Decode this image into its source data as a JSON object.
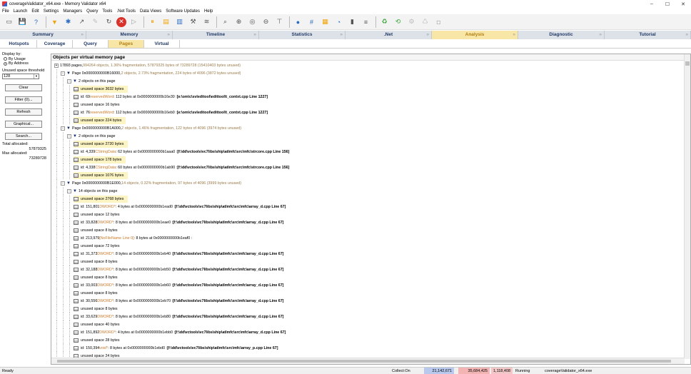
{
  "window": {
    "title": "coverageValidator_x64.exe - Memory Validator x64",
    "minimize": "–",
    "maximize": "☐",
    "close": "✕"
  },
  "menu": [
    "File",
    "Launch",
    "Edit",
    "Settings",
    "Managers",
    "Query",
    "Tools",
    ".Net Tools",
    "Data Views",
    "Software Updates",
    "Help"
  ],
  "toolbar": {
    "icons": [
      "new-file-icon",
      "save-icon",
      "help-icon",
      "filter-icon",
      "settings-icon",
      "launch-icon",
      "pen-icon",
      "refresh-icon",
      "stop-icon",
      "play-icon",
      "pause-icon",
      "chart-icon",
      "bar-chart-icon",
      "tools-icon",
      "heap-icon",
      "search-icon",
      "zoom-in-icon",
      "zoom-icon",
      "zoom-out-icon",
      "tree-icon",
      "droplet-icon",
      "hex-icon",
      "grid-icon",
      "pie-icon",
      "battery-icon",
      "list-icon",
      "recycle-green-icon",
      "recycle-back-icon",
      "gear-gray-icon",
      "recycle-gray-icon",
      "camera-icon"
    ],
    "colors": {
      "accent": "#2b6cc4",
      "stop": "#d9322b",
      "warn": "#f0a30a",
      "green": "#3aa53a"
    }
  },
  "tabs_main": [
    "Summary",
    "Memory",
    "Timeline",
    "Statistics",
    ".Net",
    "Analysis",
    "Diagnostic",
    "Tutorial"
  ],
  "tabs_main_active": "Analysis",
  "tabs_sub": [
    "Hotspots",
    "Coverage",
    "Query",
    "Pages",
    "Virtual"
  ],
  "tabs_sub_active": "Pages",
  "left": {
    "display_by": "Display by:",
    "by_usage": "By Usage",
    "by_address": "By Address",
    "threshold_label": "Unused space threshold",
    "threshold_value": "128",
    "clear": "Clear",
    "filter": "Filter (0)...",
    "refresh": "Refresh",
    "graphical": "Graphical...",
    "search": "Search...",
    "total_label": "Total allocated:",
    "total_value": "57879325",
    "max_label": "Max allocated:",
    "max_value": "73289728"
  },
  "main": {
    "header": "Objects per virtual memory page",
    "rows": [
      {
        "level": 0,
        "exp": "+",
        "t": "17893 pages, ",
        "o": "994264 objects, 1.36% fragmentation, 57879325 bytes of 73289728 (15410403 bytes unused)"
      },
      {
        "level": 1,
        "exp": "-",
        "tri": true,
        "t": "Page 0x0000000000B16000, ",
        "o": "2 objects, 2.73% fragmentation, 224 bytes of 4096 (3872 bytes unused)"
      },
      {
        "level": 2,
        "exp": "-",
        "tri": true,
        "t": "2 objects on this page"
      },
      {
        "level": 3,
        "hl": true,
        "t": "unused space 3632 bytes"
      },
      {
        "level": 3,
        "t": "id: 69 ",
        "o": "reservedWord",
        "t2": " : 112 bytes at 0x0000000000b16e30 : ",
        "b": "[e:\\om\\c\\svleditool\\edittool\\t_contxt.cpp Line 1227]"
      },
      {
        "level": 3,
        "t": "unused space 16 bytes"
      },
      {
        "level": 3,
        "t": "id: 76 ",
        "o": "reservedWord",
        "t2": " : 112 bytes at 0x0000000000b16eb0 : ",
        "b": "[e:\\om\\c\\svleditool\\edittool\\t_contxt.cpp Line 1227]"
      },
      {
        "level": 3,
        "hl": true,
        "t": "unused space 224 bytes"
      },
      {
        "level": 1,
        "exp": "-",
        "tri": true,
        "t": "Page 0x0000000000B1A000, ",
        "o": "2 objects, 1.46% fragmentation, 122 bytes of 4096 (3974 bytes unused)"
      },
      {
        "level": 2,
        "exp": "-",
        "tri": true,
        "t": "2 objects on this page"
      },
      {
        "level": 3,
        "hl": true,
        "t": "unused space 2720 bytes"
      },
      {
        "level": 3,
        "t": "id: 4,339 ",
        "o": "CStringData",
        "t2": " : 62 bytes at 0x0000000000b1aaa0 : ",
        "b": "[f:\\dd\\vctools\\vc7libs\\ship\\atlmfc\\src\\mfc\\strcore.cpp Line 156]"
      },
      {
        "level": 3,
        "hl": true,
        "t": "unused space 178 bytes"
      },
      {
        "level": 3,
        "t": "id: 4,338 ",
        "o": "CStringData",
        "t2": " : 60 bytes at 0x0000000000b1ab90 : ",
        "b": "[f:\\dd\\vctools\\vc7libs\\ship\\atlmfc\\src\\mfc\\strcore.cpp Line 156]"
      },
      {
        "level": 3,
        "hl": true,
        "t": "unused space 1076 bytes"
      },
      {
        "level": 1,
        "exp": "-",
        "tri": true,
        "t": "Page 0x0000000000B1E000, ",
        "o": "14 objects, 0.32% fragmentation, 97 bytes of 4096 (3999 bytes unused)"
      },
      {
        "level": 2,
        "exp": "-",
        "tri": true,
        "t": "14 objects on this page"
      },
      {
        "level": 3,
        "hl": true,
        "t": "unused space 2768 bytes"
      },
      {
        "level": 3,
        "t": "id: 151,801 ",
        "o": "DWORD*",
        "t2": " : 4 bytes at 0x0000000000b1ead0 : ",
        "b": "[f:\\dd\\vctools\\vc7libs\\ship\\atlmfc\\src\\mfc\\array_d.cpp Line 67]"
      },
      {
        "level": 3,
        "t": "unused space 12 bytes"
      },
      {
        "level": 3,
        "t": "id: 33,828 ",
        "o": "DWORD*",
        "t2": " : 8 bytes at 0x0000000000b1eae0 : ",
        "b": "[f:\\dd\\vctools\\vc7libs\\ship\\atlmfc\\src\\mfc\\array_d.cpp Line 67]"
      },
      {
        "level": 3,
        "t": "unused space 8 bytes"
      },
      {
        "level": 3,
        "t": "id: 213,979 ",
        "o": "[NoFileName Line 0]",
        "t2": " : 8 bytes at 0x0000000000b1eaf0 :"
      },
      {
        "level": 3,
        "t": "unused space 72 bytes"
      },
      {
        "level": 3,
        "t": "id: 31,373 ",
        "o": "DWORD*",
        "t2": " : 8 bytes at 0x0000000000b1eb40 : ",
        "b": "[f:\\dd\\vctools\\vc7libs\\ship\\atlmfc\\src\\mfc\\array_d.cpp Line 67]"
      },
      {
        "level": 3,
        "t": "unused space 8 bytes"
      },
      {
        "level": 3,
        "t": "id: 32,188 ",
        "o": "DWORD*",
        "t2": " : 8 bytes at 0x0000000000b1eb50 : ",
        "b": "[f:\\dd\\vctools\\vc7libs\\ship\\atlmfc\\src\\mfc\\array_d.cpp Line 67]"
      },
      {
        "level": 3,
        "t": "unused space 8 bytes"
      },
      {
        "level": 3,
        "t": "id: 33,003 ",
        "o": "DWORD*",
        "t2": " : 8 bytes at 0x0000000000b1eb60 : ",
        "b": "[f:\\dd\\vctools\\vc7libs\\ship\\atlmfc\\src\\mfc\\array_d.cpp Line 67]"
      },
      {
        "level": 3,
        "t": "unused space 8 bytes"
      },
      {
        "level": 3,
        "t": "id: 30,556 ",
        "o": "DWORD*",
        "t2": " : 8 bytes at 0x0000000000b1eb70 : ",
        "b": "[f:\\dd\\vctools\\vc7libs\\ship\\atlmfc\\src\\mfc\\array_d.cpp Line 67]"
      },
      {
        "level": 3,
        "t": "unused space 8 bytes"
      },
      {
        "level": 3,
        "t": "id: 33,629 ",
        "o": "DWORD*",
        "t2": " : 8 bytes at 0x0000000000b1eb80 : ",
        "b": "[f:\\dd\\vctools\\vc7libs\\ship\\atlmfc\\src\\mfc\\array_d.cpp Line 67]"
      },
      {
        "level": 3,
        "t": "unused space 40 bytes"
      },
      {
        "level": 3,
        "t": "id: 151,892 ",
        "o": "DWORD*",
        "t2": " : 4 bytes at 0x0000000000b1ebb0 : ",
        "b": "[f:\\dd\\vctools\\vc7libs\\ship\\atlmfc\\src\\mfc\\array_d.cpp Line 67]"
      },
      {
        "level": 3,
        "t": "unused space 28 bytes"
      },
      {
        "level": 3,
        "t": "id: 150,394 ",
        "o": "void*",
        "t2": " : 8 bytes at 0x0000000000b1ebd0 : ",
        "b": "[f:\\dd\\vctools\\vc7libs\\ship\\atlmfc\\src\\mfc\\array_p.cpp Line 67]"
      },
      {
        "level": 3,
        "t": "unused space 24 bytes"
      }
    ]
  },
  "status": {
    "ready": "Ready",
    "collect": "Collect:On",
    "v1": "21,142,671",
    "v2": "35,684,425",
    "v3": "1,118,408",
    "running": "Running",
    "exe": "coverageValidator_x64.exe",
    "colors": {
      "v1": "#b9c9ee",
      "v2": "#f3b4b4",
      "v3": "#f3c7c7"
    }
  }
}
